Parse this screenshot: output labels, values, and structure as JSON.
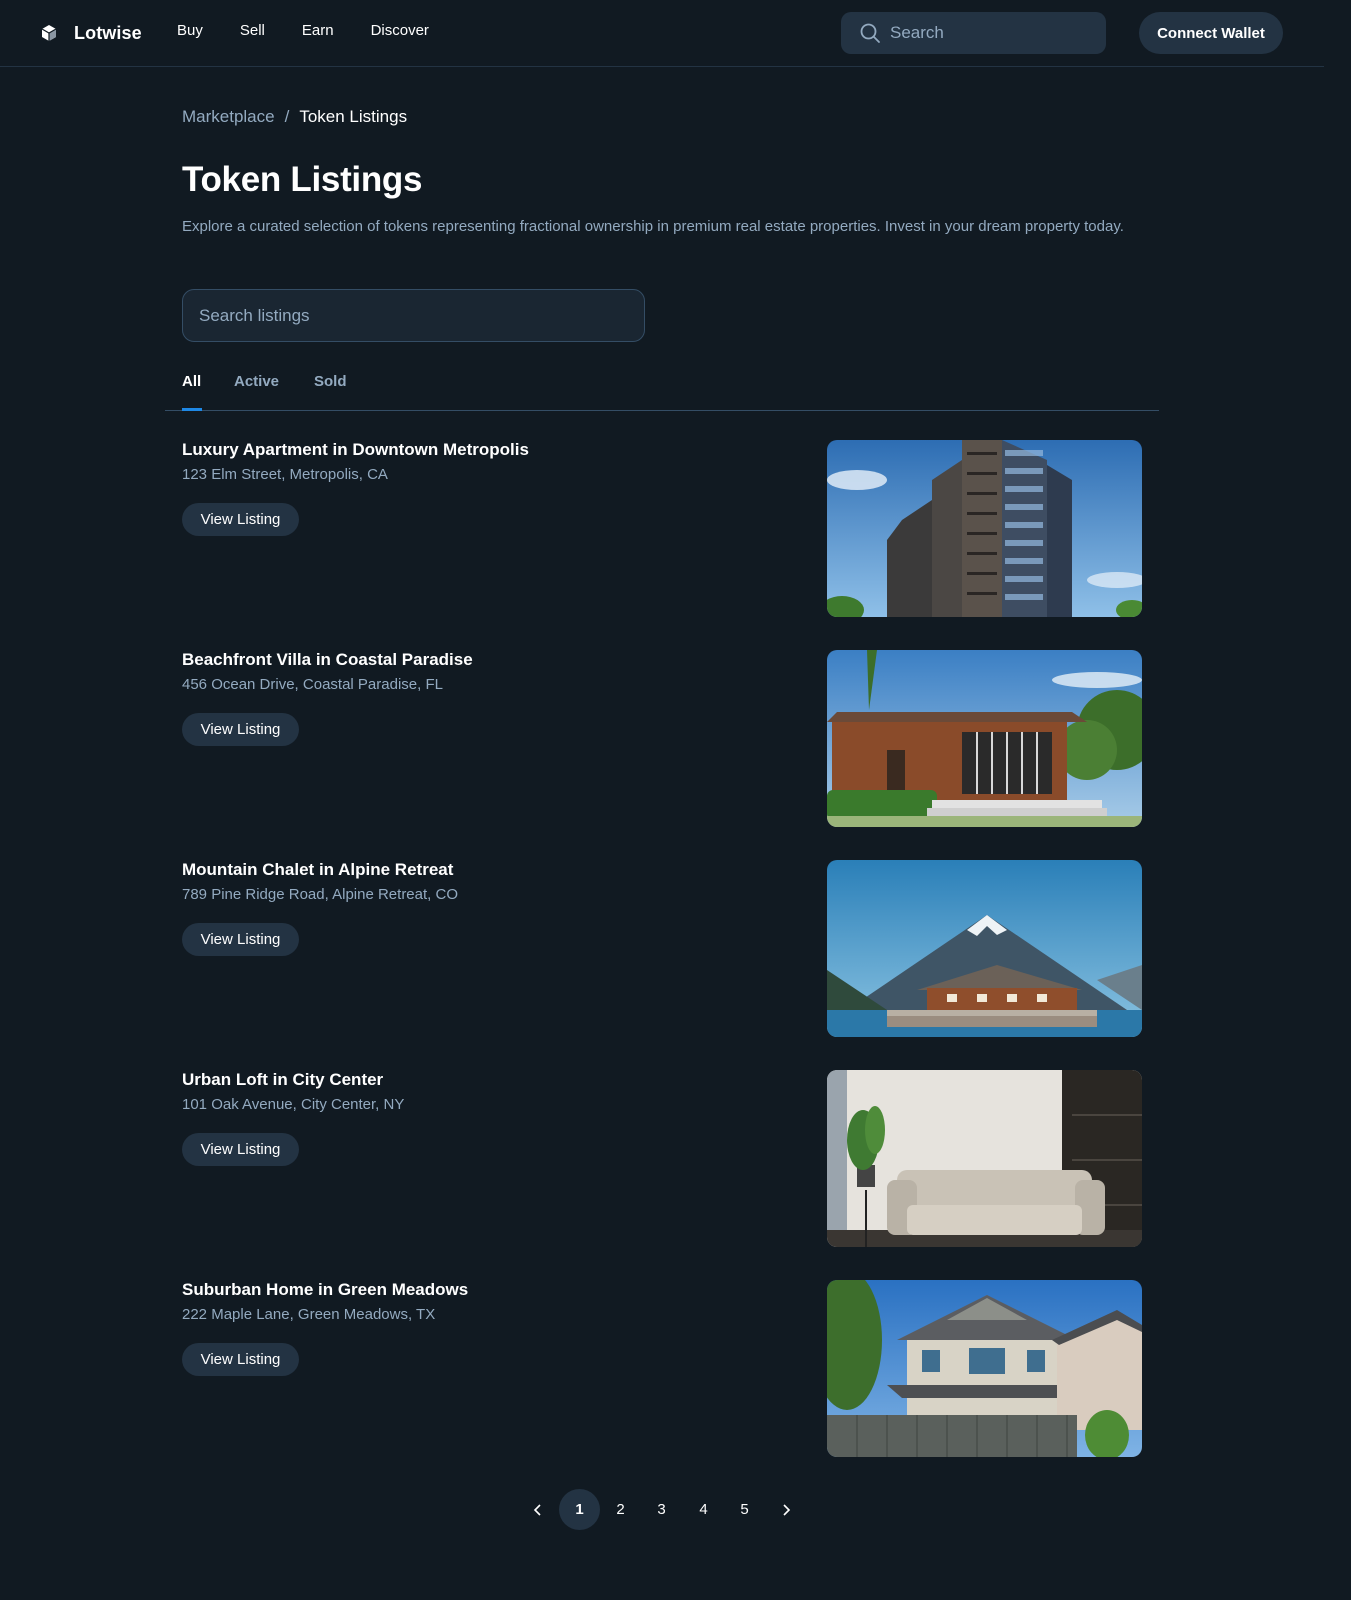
{
  "header": {
    "brand": "Lotwise",
    "nav": [
      "Buy",
      "Sell",
      "Earn",
      "Discover"
    ],
    "search_placeholder": "Search",
    "connect_label": "Connect Wallet"
  },
  "breadcrumb": {
    "root": "Marketplace",
    "separator": "/",
    "current": "Token Listings"
  },
  "page": {
    "title": "Token Listings",
    "description": "Explore a curated selection of tokens representing fractional ownership in premium real estate properties. Invest in your dream property today.",
    "search_placeholder": "Search listings"
  },
  "tabs": [
    {
      "label": "All",
      "active": true
    },
    {
      "label": "Active",
      "active": false
    },
    {
      "label": "Sold",
      "active": false
    }
  ],
  "listings": [
    {
      "title": "Luxury Apartment in Downtown Metropolis",
      "address": "123 Elm Street, Metropolis, CA",
      "button": "View Listing",
      "image": "high-rise-apartment-photo"
    },
    {
      "title": "Beachfront Villa in Coastal Paradise",
      "address": "456 Ocean Drive, Coastal Paradise, FL",
      "button": "View Listing",
      "image": "beachfront-villa-photo"
    },
    {
      "title": "Mountain Chalet in Alpine Retreat",
      "address": "789 Pine Ridge Road, Alpine Retreat, CO",
      "button": "View Listing",
      "image": "mountain-chalet-photo"
    },
    {
      "title": "Urban Loft in City Center",
      "address": "101 Oak Avenue, City Center, NY",
      "button": "View Listing",
      "image": "urban-loft-interior-photo"
    },
    {
      "title": "Suburban Home in Green Meadows",
      "address": "222 Maple Lane, Green Meadows, TX",
      "button": "View Listing",
      "image": "suburban-house-photo"
    }
  ],
  "pagination": {
    "pages": [
      "1",
      "2",
      "3",
      "4",
      "5"
    ],
    "current": "1"
  },
  "colors": {
    "background": "#111a22",
    "surface": "#233343",
    "muted_text": "#93aac0",
    "accent": "#1e88e5",
    "border": "#344d65"
  }
}
